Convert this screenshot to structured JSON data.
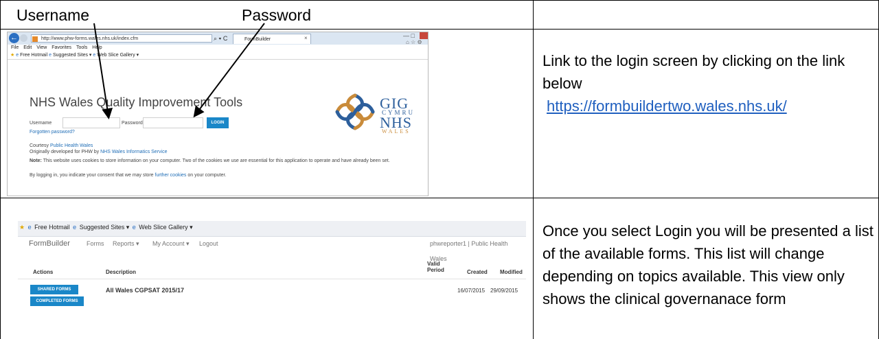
{
  "callouts": {
    "username": "Username",
    "password": "Password"
  },
  "row1": {
    "text": "Link to the login screen by clicking on the link below",
    "link": "https://formbuildertwo.wales.nhs.uk/"
  },
  "row2": {
    "text": "Once you select Login you will be presented a list of the available forms. This list will change depending on topics available. This view only shows the clinical governanace form"
  },
  "browser": {
    "address": "http://www.phw-forms.wales.nhs.uk/index.cfm",
    "address_tools": "⌕ ▾ C",
    "tab_title": "FormBuilder",
    "menu": [
      "File",
      "Edit",
      "View",
      "Favorites",
      "Tools",
      "Help"
    ],
    "favorites": [
      {
        "label": "Free Hotmail"
      },
      {
        "label": "Suggested Sites ▾"
      },
      {
        "label": "Web Slice Gallery ▾"
      }
    ]
  },
  "login_page": {
    "title": "NHS Wales Quality Improvement Tools",
    "username_label": "Username",
    "password_label": "Password",
    "login_button": "LOGIN",
    "forgotten": "Forgotten password?",
    "courtesy_prefix": "Courtesy ",
    "courtesy_link": "Public Health Wales",
    "originally_prefix": "Originally developed for PHW by ",
    "originally_link": "NHS Wales Informatics Service",
    "note_label": "Note:",
    "note_text": " This website uses cookies to store information on your computer. Two of the cookies we use are essential for this application to operate and have already been set.",
    "consent_prefix": "By logging in, you indicate your consent that we may store ",
    "consent_link": "further cookies",
    "consent_suffix": " on your computer.",
    "logo": {
      "gig": "GIG",
      "cymru": "CYMRU",
      "nhs": "NHS",
      "wales": "WALES"
    }
  },
  "formbuilder": {
    "favorites": [
      "Free Hotmail",
      "Suggested Sites ▾",
      "Web Slice Gallery ▾"
    ],
    "brand": "FormBuilder",
    "nav": [
      "Forms",
      "Reports ▾",
      "My Account ▾",
      "Logout"
    ],
    "user": "phwreporter1 | Public Health Wales",
    "columns": {
      "actions": "Actions",
      "description": "Description",
      "valid": "Valid",
      "period": "Period",
      "created": "Created",
      "modified": "Modified"
    },
    "rows": [
      {
        "buttons": [
          "SHARED FORMS",
          "COMPLETED FORMS"
        ],
        "description": "All Wales CGPSAT 2015/17",
        "created": "16/07/2015",
        "modified": "29/09/2015"
      }
    ]
  },
  "colors": {
    "accent_blue": "#1a87c8",
    "link_blue": "#1f5fbf",
    "logo_blue": "#2d5f9c",
    "logo_gold": "#c98b3a"
  }
}
